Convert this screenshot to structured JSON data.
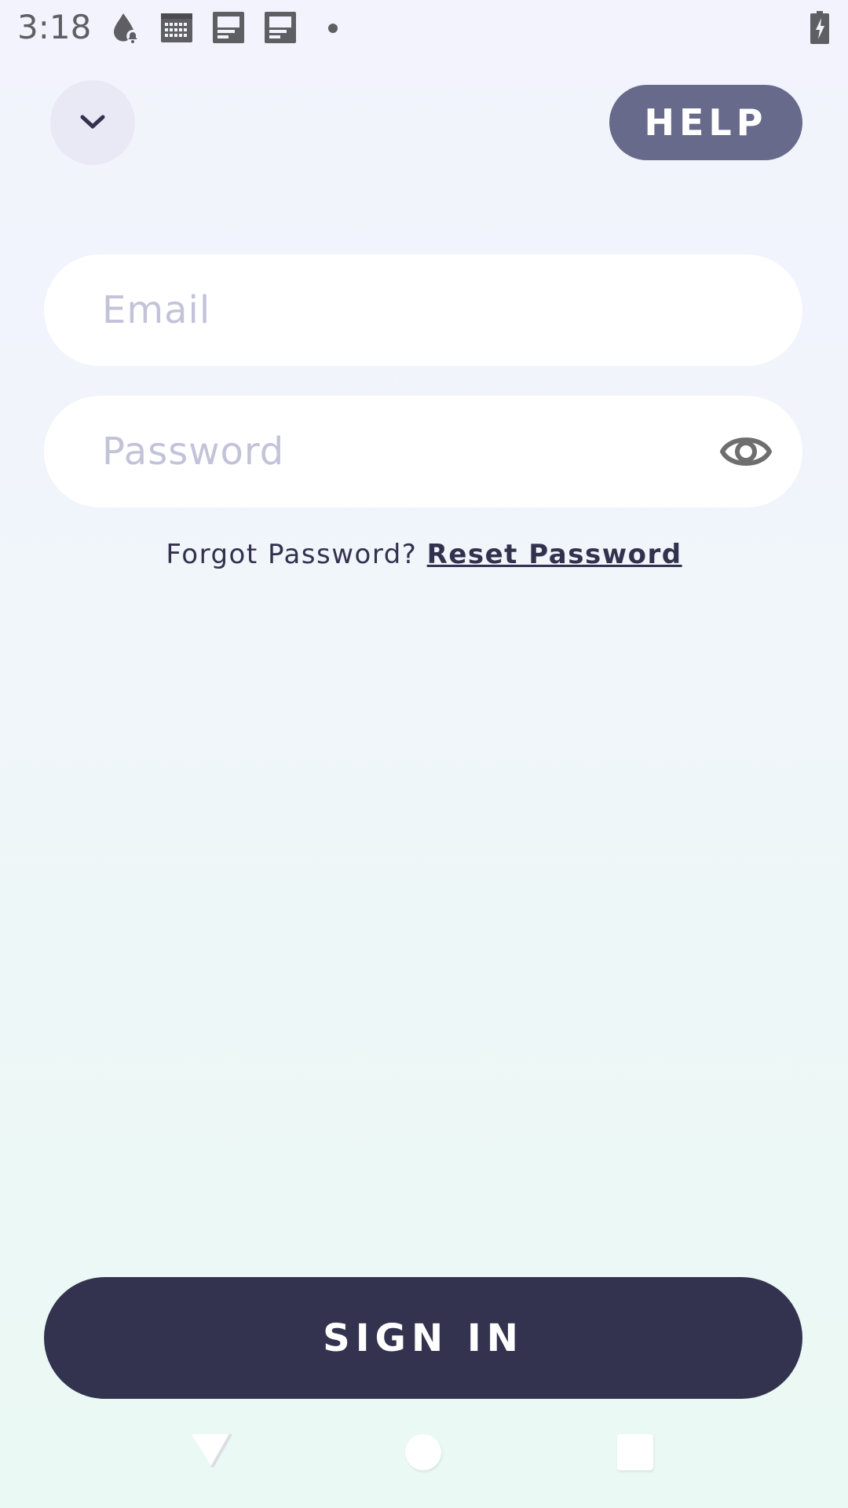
{
  "status_bar": {
    "time": "3:18",
    "icons": [
      "drop-alert-icon",
      "calendar-icon",
      "document-icon",
      "document-icon",
      "dot-icon",
      "battery-charging-icon"
    ]
  },
  "header": {
    "collapse_icon": "chevron-down-icon",
    "help_label": "HELP"
  },
  "form": {
    "email": {
      "placeholder": "Email",
      "value": ""
    },
    "password": {
      "placeholder": "Password",
      "value": "",
      "toggle_icon": "eye-icon"
    },
    "forgot_text": "Forgot Password?",
    "reset_link": "Reset Password"
  },
  "actions": {
    "sign_in_label": "SIGN IN"
  },
  "nav_bar": {
    "icons": [
      "back-icon",
      "home-icon",
      "recents-icon"
    ]
  },
  "colors": {
    "primary": "#33334f",
    "help_button": "#676a8b",
    "placeholder": "#c2c3d9",
    "field_bg": "#ffffff"
  }
}
